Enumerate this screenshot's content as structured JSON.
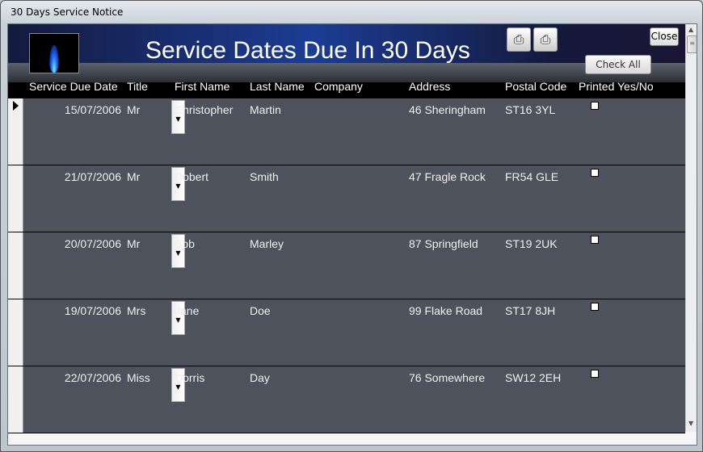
{
  "window": {
    "title": "30 Days Service Notice"
  },
  "header": {
    "title": "Service Dates Due In 30 Days",
    "close_label": "Close",
    "check_all_label": "Check All"
  },
  "columns": [
    "Service Due Date",
    "Title",
    "First Name",
    "Last Name",
    "Company",
    "Address",
    "Postal Code",
    "Printed Yes/No"
  ],
  "rows": [
    {
      "date": "15/07/2006",
      "title": "Mr",
      "first": "Christopher",
      "last": "Martin",
      "company": "",
      "address": "46 Sheringham",
      "postal": "ST16 3YL"
    },
    {
      "date": "21/07/2006",
      "title": "Mr",
      "first": "Robert",
      "last": "Smith",
      "company": "",
      "address": "47 Fragle Rock",
      "postal": "FR54 GLE"
    },
    {
      "date": "20/07/2006",
      "title": "Mr",
      "first": "Bob",
      "last": "Marley",
      "company": "",
      "address": "87 Springfield",
      "postal": "ST19 2UK"
    },
    {
      "date": "19/07/2006",
      "title": "Mrs",
      "first": "Jane",
      "last": "Doe",
      "company": "",
      "address": "99 Flake Road",
      "postal": "ST17 8JH"
    },
    {
      "date": "22/07/2006",
      "title": "Miss",
      "first": "Dorris",
      "last": "Day",
      "company": "",
      "address": "76 Somewhere",
      "postal": "SW12 2EH"
    }
  ]
}
